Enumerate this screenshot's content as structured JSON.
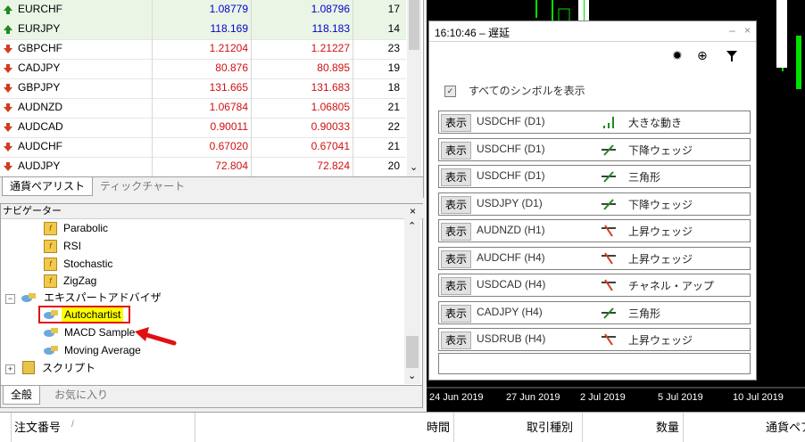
{
  "market_watch": {
    "rows": [
      {
        "symbol": "EURCHF",
        "bid": "1.08779",
        "ask": "1.08796",
        "spread": "17",
        "dir": "up"
      },
      {
        "symbol": "EURJPY",
        "bid": "118.169",
        "ask": "118.183",
        "spread": "14",
        "dir": "up"
      },
      {
        "symbol": "GBPCHF",
        "bid": "1.21204",
        "ask": "1.21227",
        "spread": "23",
        "dir": "down"
      },
      {
        "symbol": "CADJPY",
        "bid": "80.876",
        "ask": "80.895",
        "spread": "19",
        "dir": "down"
      },
      {
        "symbol": "GBPJPY",
        "bid": "131.665",
        "ask": "131.683",
        "spread": "18",
        "dir": "down"
      },
      {
        "symbol": "AUDNZD",
        "bid": "1.06784",
        "ask": "1.06805",
        "spread": "21",
        "dir": "down"
      },
      {
        "symbol": "AUDCAD",
        "bid": "0.90011",
        "ask": "0.90033",
        "spread": "22",
        "dir": "down"
      },
      {
        "symbol": "AUDCHF",
        "bid": "0.67020",
        "ask": "0.67041",
        "spread": "21",
        "dir": "down"
      },
      {
        "symbol": "AUDJPY",
        "bid": "72.804",
        "ask": "72.824",
        "spread": "20",
        "dir": "down"
      }
    ],
    "tabs": [
      "通貨ペアリスト",
      "ティックチャート"
    ]
  },
  "navigator": {
    "title": "ナビゲーター",
    "close": "×",
    "indicators": [
      "Parabolic",
      "RSI",
      "Stochastic",
      "ZigZag"
    ],
    "experts_folder": "エキスパートアドバイザ",
    "experts": [
      "Autochartist",
      "MACD Sample",
      "Moving Average"
    ],
    "scripts_folder": "スクリプト",
    "tabs": [
      "全般",
      "お気に入り"
    ]
  },
  "autochartist": {
    "title": "16:10:46 – 遅延",
    "window_controls": [
      "–",
      "×"
    ],
    "show_all_label": "すべてのシンボルを表示",
    "show_all_checked": true,
    "button_label": "表示",
    "rows": [
      {
        "symbol": "USDCHF (D1)",
        "pattern": "大きな動き",
        "trend": "up"
      },
      {
        "symbol": "USDCHF (D1)",
        "pattern": "下降ウェッジ",
        "trend": "up"
      },
      {
        "symbol": "USDCHF (D1)",
        "pattern": "三角形",
        "trend": "up"
      },
      {
        "symbol": "USDJPY (D1)",
        "pattern": "下降ウェッジ",
        "trend": "up"
      },
      {
        "symbol": "AUDNZD (H1)",
        "pattern": "上昇ウェッジ",
        "trend": "down"
      },
      {
        "symbol": "AUDCHF (H4)",
        "pattern": "上昇ウェッジ",
        "trend": "down"
      },
      {
        "symbol": "USDCAD (H4)",
        "pattern": "チャネル・アップ",
        "trend": "down"
      },
      {
        "symbol": "CADJPY (H4)",
        "pattern": "三角形",
        "trend": "up"
      },
      {
        "symbol": "USDRUB (H4)",
        "pattern": "上昇ウェッジ",
        "trend": "down"
      }
    ]
  },
  "chart": {
    "dates": [
      "24 Jun 2019",
      "27 Jun 2019",
      "2 Jul 2019",
      "5 Jul 2019",
      "10 Jul 2019"
    ]
  },
  "terminal": {
    "columns": [
      "注文番号",
      "時間",
      "取引種別",
      "数量",
      "通貨ペア"
    ]
  },
  "colors": {
    "bid": "#0000cc",
    "ask": "#0000cc",
    "up": "#1e8b1e",
    "down": "#d23c1e",
    "highlight": "#ffff00",
    "annotation": "#e01010"
  }
}
